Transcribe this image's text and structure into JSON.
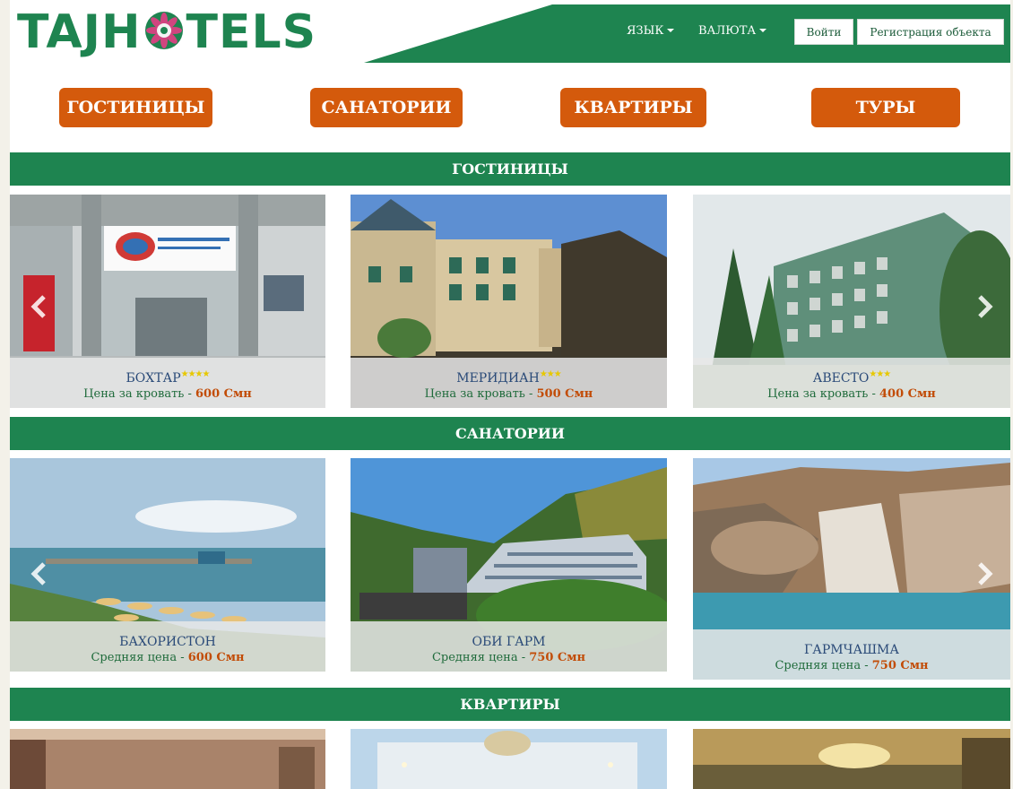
{
  "header": {
    "logo_left": "TAJH",
    "logo_right": "TELS",
    "language_label": "ЯЗЫК",
    "currency_label": "ВАЛЮТА",
    "login_label": "Войти",
    "register_label": "Регистрация объекта"
  },
  "categories": [
    "ГОСТИНИЦЫ",
    "САНАТОРИИ",
    "КВАРТИРЫ",
    "ТУРЫ"
  ],
  "sections": {
    "hotels": {
      "title": "ГОСТИНИЦЫ",
      "items": [
        {
          "name": "БОХТАР",
          "stars": "★★★★",
          "price_label": "Цена за кровать - ",
          "price": "600 Смн"
        },
        {
          "name": "МЕРИДИАН",
          "stars": "★★★",
          "price_label": "Цена за кровать - ",
          "price": "500 Смн"
        },
        {
          "name": "АВЕСТО",
          "stars": "★★★",
          "price_label": "Цена за кровать - ",
          "price": "400 Смн"
        }
      ]
    },
    "sanatoriums": {
      "title": "САНАТОРИИ",
      "items": [
        {
          "name": "БАХОРИСТОН",
          "price_label": "Средняя цена - ",
          "price": "600 Смн"
        },
        {
          "name": "ОБИ ГАРМ",
          "price_label": "Средняя цена - ",
          "price": "750 Смн"
        },
        {
          "name": "ГАРМЧАШМА",
          "price_label": "Средняя цена - ",
          "price": "750 Смн"
        }
      ]
    },
    "apartments": {
      "title": "КВАРТИРЫ"
    }
  },
  "colors": {
    "brand_green": "#1e8450",
    "accent_orange": "#d45a0c",
    "price_orange": "#c24c07",
    "star_yellow": "#e7c800"
  }
}
